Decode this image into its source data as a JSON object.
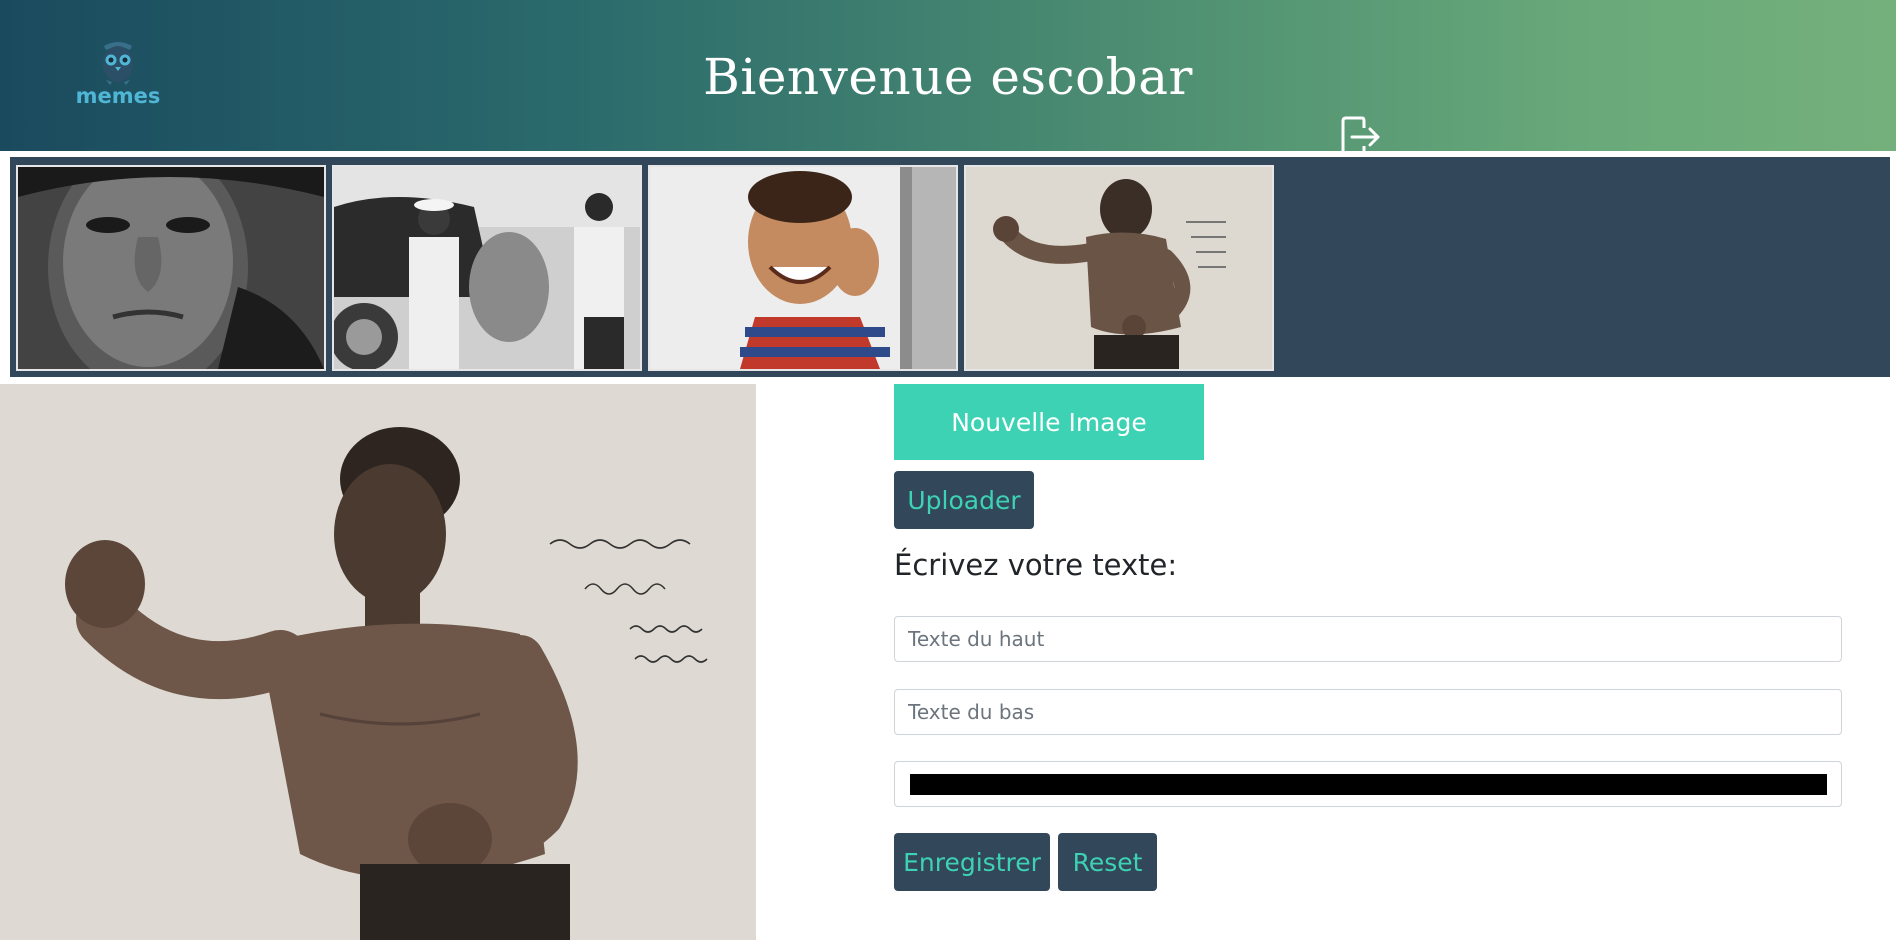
{
  "header": {
    "logo_text": "memes",
    "title": "Bienvenue escobar",
    "logout_icon": "logout-icon",
    "colors": {
      "gradient_start": "#1a4a5e",
      "gradient_end": "#74b07c",
      "logo": "#4fb6d6"
    }
  },
  "gallery": {
    "background": "#33475b",
    "thumbnails": [
      {
        "name": "boy-portrait-bw"
      },
      {
        "name": "family-car-bw"
      },
      {
        "name": "smiling-child"
      },
      {
        "name": "boxer-sepia"
      }
    ]
  },
  "main_image": {
    "name": "boxer-sepia"
  },
  "controls": {
    "new_image_label": "Nouvelle Image",
    "upload_label": "Uploader",
    "write_text_label": "Écrivez votre texte:",
    "top_text_placeholder": "Texte du haut",
    "top_text_value": "",
    "bottom_text_placeholder": "Texte du bas",
    "bottom_text_value": "",
    "text_color": "#000000",
    "save_label": "Enregistrer",
    "reset_label": "Reset",
    "colors": {
      "accent": "#3cd2b3",
      "dark_button": "#33475b"
    }
  }
}
